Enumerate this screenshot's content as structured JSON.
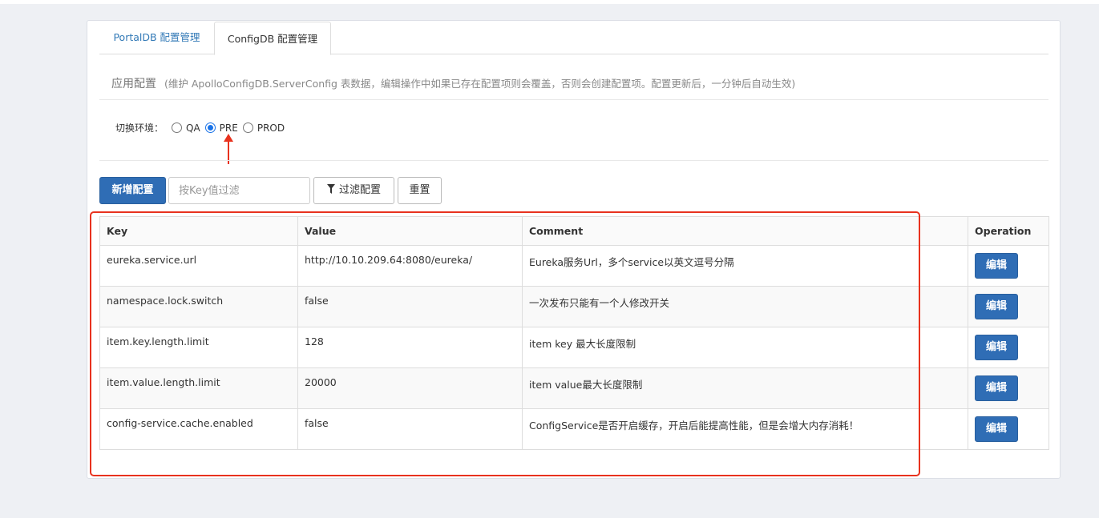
{
  "tabs": [
    {
      "label": "PortalDB 配置管理",
      "active": false
    },
    {
      "label": "ConfigDB 配置管理",
      "active": true
    }
  ],
  "section": {
    "title": "应用配置",
    "description": "(维护 ApolloConfigDB.ServerConfig 表数据，编辑操作中如果已存在配置项则会覆盖，否则会创建配置项。配置更新后，一分钟后自动生效)"
  },
  "env": {
    "label": "切换环境：",
    "options": [
      "QA",
      "PRE",
      "PROD"
    ],
    "selected": "PRE"
  },
  "toolbar": {
    "add_label": "新增配置",
    "filter_placeholder": "按Key值过滤",
    "filter_value": "",
    "filter_button": "过滤配置",
    "reset_button": "重置"
  },
  "table": {
    "headers": [
      "Key",
      "Value",
      "Comment",
      "Operation"
    ],
    "rows": [
      {
        "key": "eureka.service.url",
        "value": "http://10.10.209.64:8080/eureka/",
        "comment": "Eureka服务Url，多个service以英文逗号分隔",
        "action": "编辑"
      },
      {
        "key": "namespace.lock.switch",
        "value": "false",
        "comment": "一次发布只能有一个人修改开关",
        "action": "编辑"
      },
      {
        "key": "item.key.length.limit",
        "value": "128",
        "comment": "item key 最大长度限制",
        "action": "编辑"
      },
      {
        "key": "item.value.length.limit",
        "value": "20000",
        "comment": "item value最大长度限制",
        "action": "编辑"
      },
      {
        "key": "config-service.cache.enabled",
        "value": "false",
        "comment": "ConfigService是否开启缓存，开启后能提高性能，但是会增大内存消耗！",
        "action": "编辑"
      }
    ]
  },
  "colors": {
    "primary": "#2f6db5",
    "link": "#337ab7",
    "annotation": "#e8321e"
  }
}
